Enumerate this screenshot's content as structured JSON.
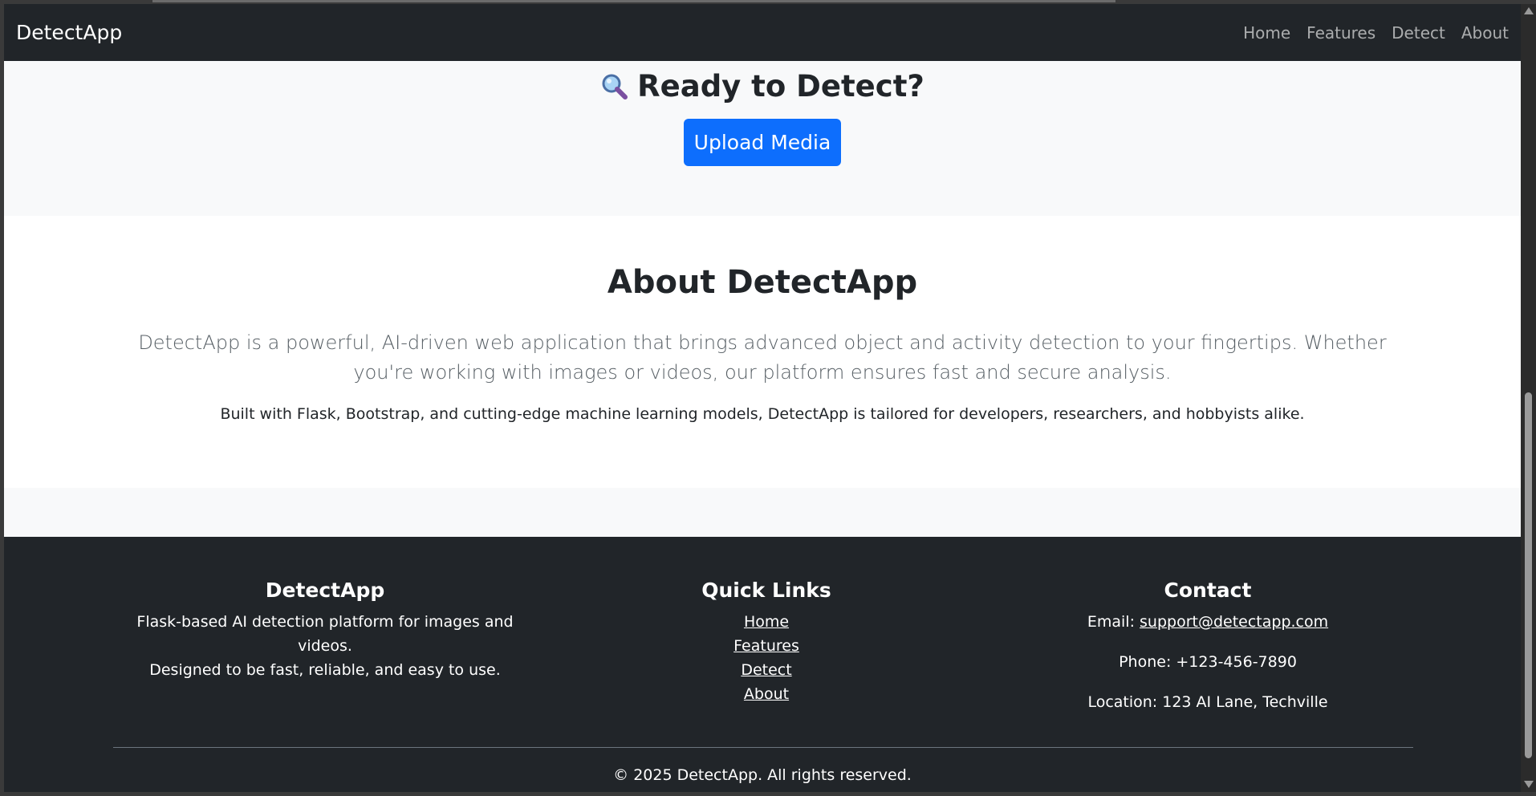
{
  "navbar": {
    "brand": "DetectApp",
    "links": [
      "Home",
      "Features",
      "Detect",
      "About"
    ]
  },
  "ready": {
    "icon": "magnifier-icon",
    "title": "Ready to Detect?",
    "button_label": "Upload Media"
  },
  "about": {
    "title": "About DetectApp",
    "lead": "DetectApp is a powerful, AI-driven web application that brings advanced object and activity detection to your fingertips. Whether you're working with images or videos, our platform ensures fast and secure analysis.",
    "text": "Built with Flask, Bootstrap, and cutting-edge machine learning models, DetectApp is tailored for developers, researchers, and hobbyists alike."
  },
  "footer": {
    "col1": {
      "title": "DetectApp",
      "line1": "Flask-based AI detection platform for images and videos.",
      "line2": "Designed to be fast, reliable, and easy to use."
    },
    "col2": {
      "title": "Quick Links",
      "links": [
        "Home",
        "Features",
        "Detect",
        "About"
      ]
    },
    "col3": {
      "title": "Contact",
      "email_label": "Email: ",
      "email": "support@detectapp.com",
      "phone": "Phone: +123-456-7890",
      "location": "Location: 123 AI Lane, Techville"
    },
    "copyright": "© 2025 DetectApp. All rights reserved."
  },
  "colors": {
    "navbar_bg": "#212529",
    "primary": "#0d6efd",
    "light_bg": "#f8f9fa"
  }
}
